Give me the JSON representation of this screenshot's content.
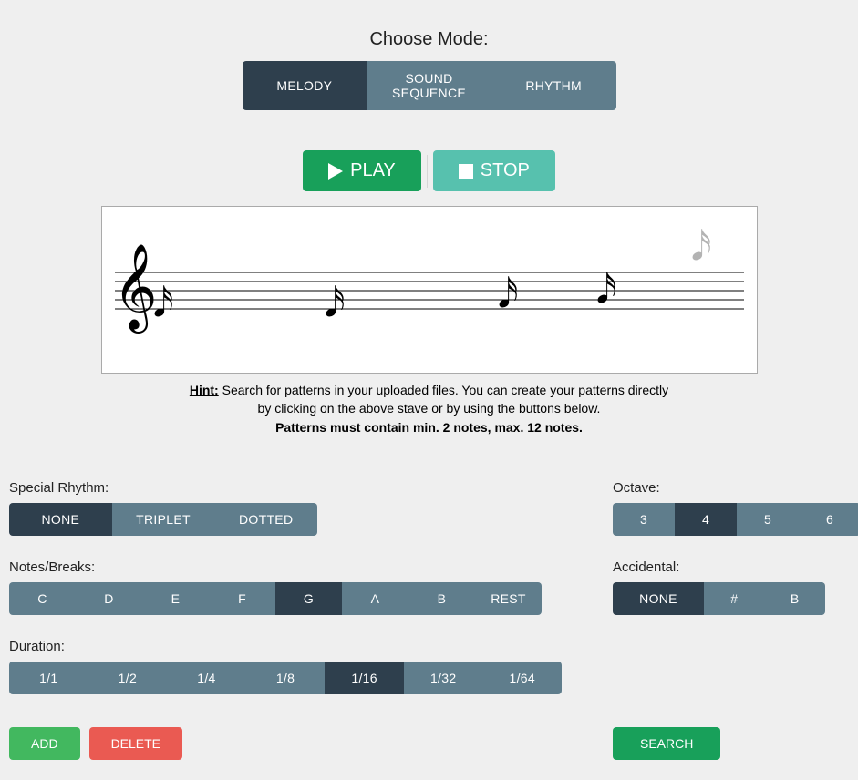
{
  "mode": {
    "title": "Choose Mode:",
    "options": [
      "MELODY",
      "SOUND SEQUENCE",
      "RHYTHM"
    ],
    "active": "MELODY"
  },
  "playback": {
    "play_label": "PLAY",
    "stop_label": "STOP"
  },
  "hint": {
    "prefix": "Hint:",
    "line1": " Search for patterns in your uploaded files. You can create your patterns directly",
    "line2": "by clicking on the above stave or by using the buttons below.",
    "line3": "Patterns must contain min. 2 notes, max. 12 notes."
  },
  "special_rhythm": {
    "label": "Special Rhythm:",
    "options": [
      "NONE",
      "TRIPLET",
      "DOTTED"
    ],
    "active": "NONE"
  },
  "notes": {
    "label": "Notes/Breaks:",
    "options": [
      "C",
      "D",
      "E",
      "F",
      "G",
      "A",
      "B",
      "REST"
    ],
    "active": "G"
  },
  "duration": {
    "label": "Duration:",
    "options": [
      "1/1",
      "1/2",
      "1/4",
      "1/8",
      "1/16",
      "1/32",
      "1/64"
    ],
    "active": "1/16"
  },
  "octave": {
    "label": "Octave:",
    "options": [
      "3",
      "4",
      "5",
      "6"
    ],
    "active": "4"
  },
  "accidental": {
    "label": "Accidental:",
    "options": [
      "NONE",
      "#",
      "B"
    ],
    "active": "NONE"
  },
  "actions": {
    "add": "ADD",
    "delete": "DELETE",
    "search": "SEARCH"
  },
  "stave_notes": [
    "E4",
    "E4",
    "G4",
    "A4"
  ]
}
